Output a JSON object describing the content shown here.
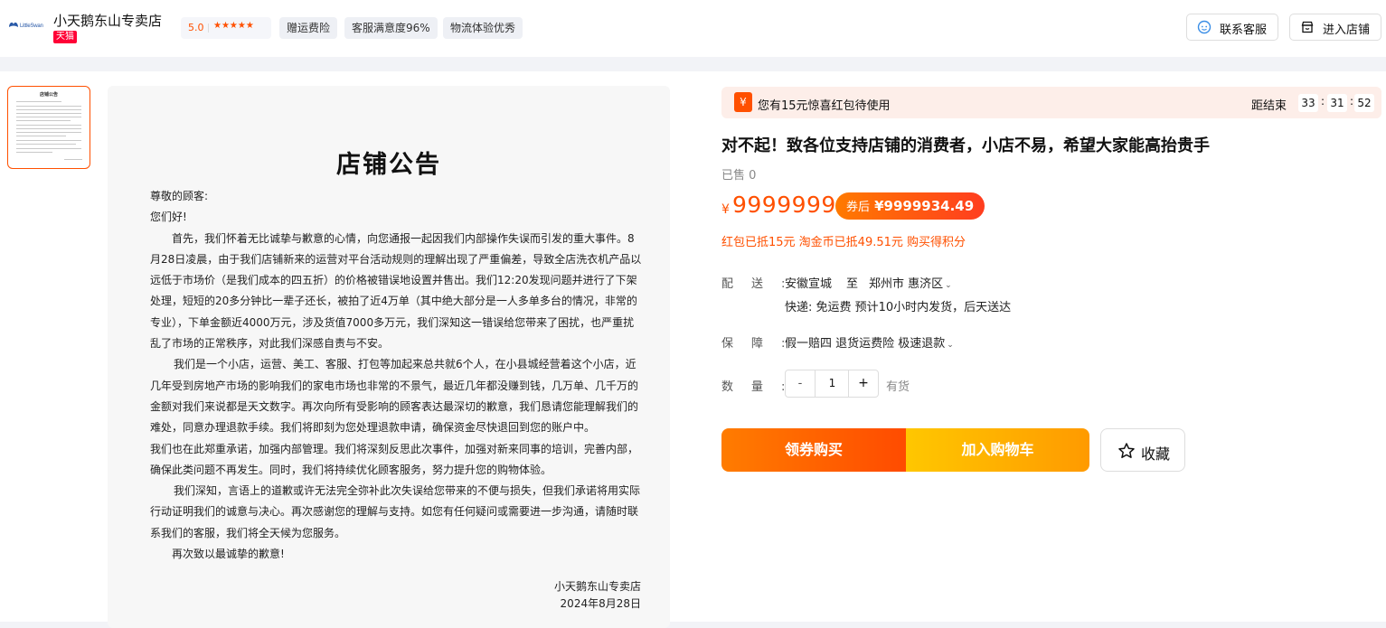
{
  "header": {
    "logo_text": "LittleSwan",
    "store_name": "小天鹅东山专卖店",
    "tmall_badge": "天猫",
    "rating": "5.0",
    "stars": "★★★★★",
    "tags": [
      "赠运费险",
      "客服满意度96%",
      "物流体验优秀"
    ],
    "contact_label": "联系客服",
    "enter_store_label": "进入店铺"
  },
  "thumbnail": {
    "title": "店铺公告"
  },
  "notice": {
    "title": "店铺公告",
    "greeting": "尊敬的顾客:",
    "hello": "您们好!",
    "paragraphs": [
      "首先，我们怀着无比诚挚与歉意的心情，向您通报一起因我们内部操作失误而引发的重大事件。8月28日凌晨，由于我们店铺新来的运营对平台活动规则的理解出现了严重偏差，导致全店洗衣机产品以远低于市场价（是我们成本的四五折）的价格被错误地设置并售出。我们12:20发现问题并进行了下架处理，短短的20多分钟比一辈子还长，被拍了近4万单（其中绝大部分是一人多单多台的情况，非常的专业），下单金额近4000万元，涉及货值7000多万元，我们深知这一错误给您带来了困扰，也严重扰乱了市场的正常秩序，对此我们深感自责与不安。",
      "我们是一个小店，运营、美工、客服、打包等加起来总共就6个人，在小县城经营着这个小店，近几年受到房地产市场的影响我们的家电市场也非常的不景气，最近几年都没赚到钱，几万单、几千万的金额对我们来说都是天文数字。再次向所有受影响的顾客表达最深切的歉意，我们恳请您能理解我们的难处，同意办理退款手续。我们将即刻为您处理退款申请，确保资金尽快退回到您的账户中。",
      "我们也在此郑重承诺，加强内部管理。我们将深刻反思此次事件，加强对新来同事的培训，完善内部，确保此类问题不再发生。同时，我们将持续优化顾客服务，努力提升您的购物体验。",
      "我们深知，言语上的道歉或许无法完全弥补此次失误给您带来的不便与损失，但我们承诺将用实际行动证明我们的诚意与决心。再次感谢您的理解与支持。如您有任何疑问或需要进一步沟通，请随时联系我们的客服，我们将全天候为您服务。",
      "再次致以最诚挚的歉意!"
    ],
    "signature": "小天鹅东山专卖店",
    "date": "2024年8月28日"
  },
  "promo": {
    "icon": "¥",
    "text": "您有15元惊喜红包待使用",
    "countdown_label": "距结束",
    "hours": "33",
    "minutes": "31",
    "seconds": "52"
  },
  "product": {
    "title": "对不起！致各位支持店铺的消费者，小店不易，希望大家能高抬贵手",
    "sold": "已售 0",
    "currency": "¥",
    "price": "9999999",
    "coupon_label": "券后",
    "coupon_price": "¥9999934.49",
    "sub_promo": "红包已抵15元 淘金币已抵49.51元 购买得积分"
  },
  "delivery": {
    "label": "配送:",
    "from": "安徽宣城",
    "to_word": "至",
    "to": "郑州市 惠济区",
    "detail": "快递: 免运费  预计10小时内发货，后天送达"
  },
  "guarantee": {
    "label": "保障:",
    "value": "假一赔四 退货运费险 极速退款"
  },
  "quantity": {
    "label": "数量:",
    "minus": "-",
    "value": "1",
    "plus": "+",
    "stock": "有货"
  },
  "actions": {
    "buy_label": "领券购买",
    "cart_label": "加入购物车",
    "fav_label": "收藏"
  },
  "colors": {
    "accent": "#ff5000",
    "tmall_red": "#ff0036",
    "cart_yellow": "#ffc700"
  }
}
